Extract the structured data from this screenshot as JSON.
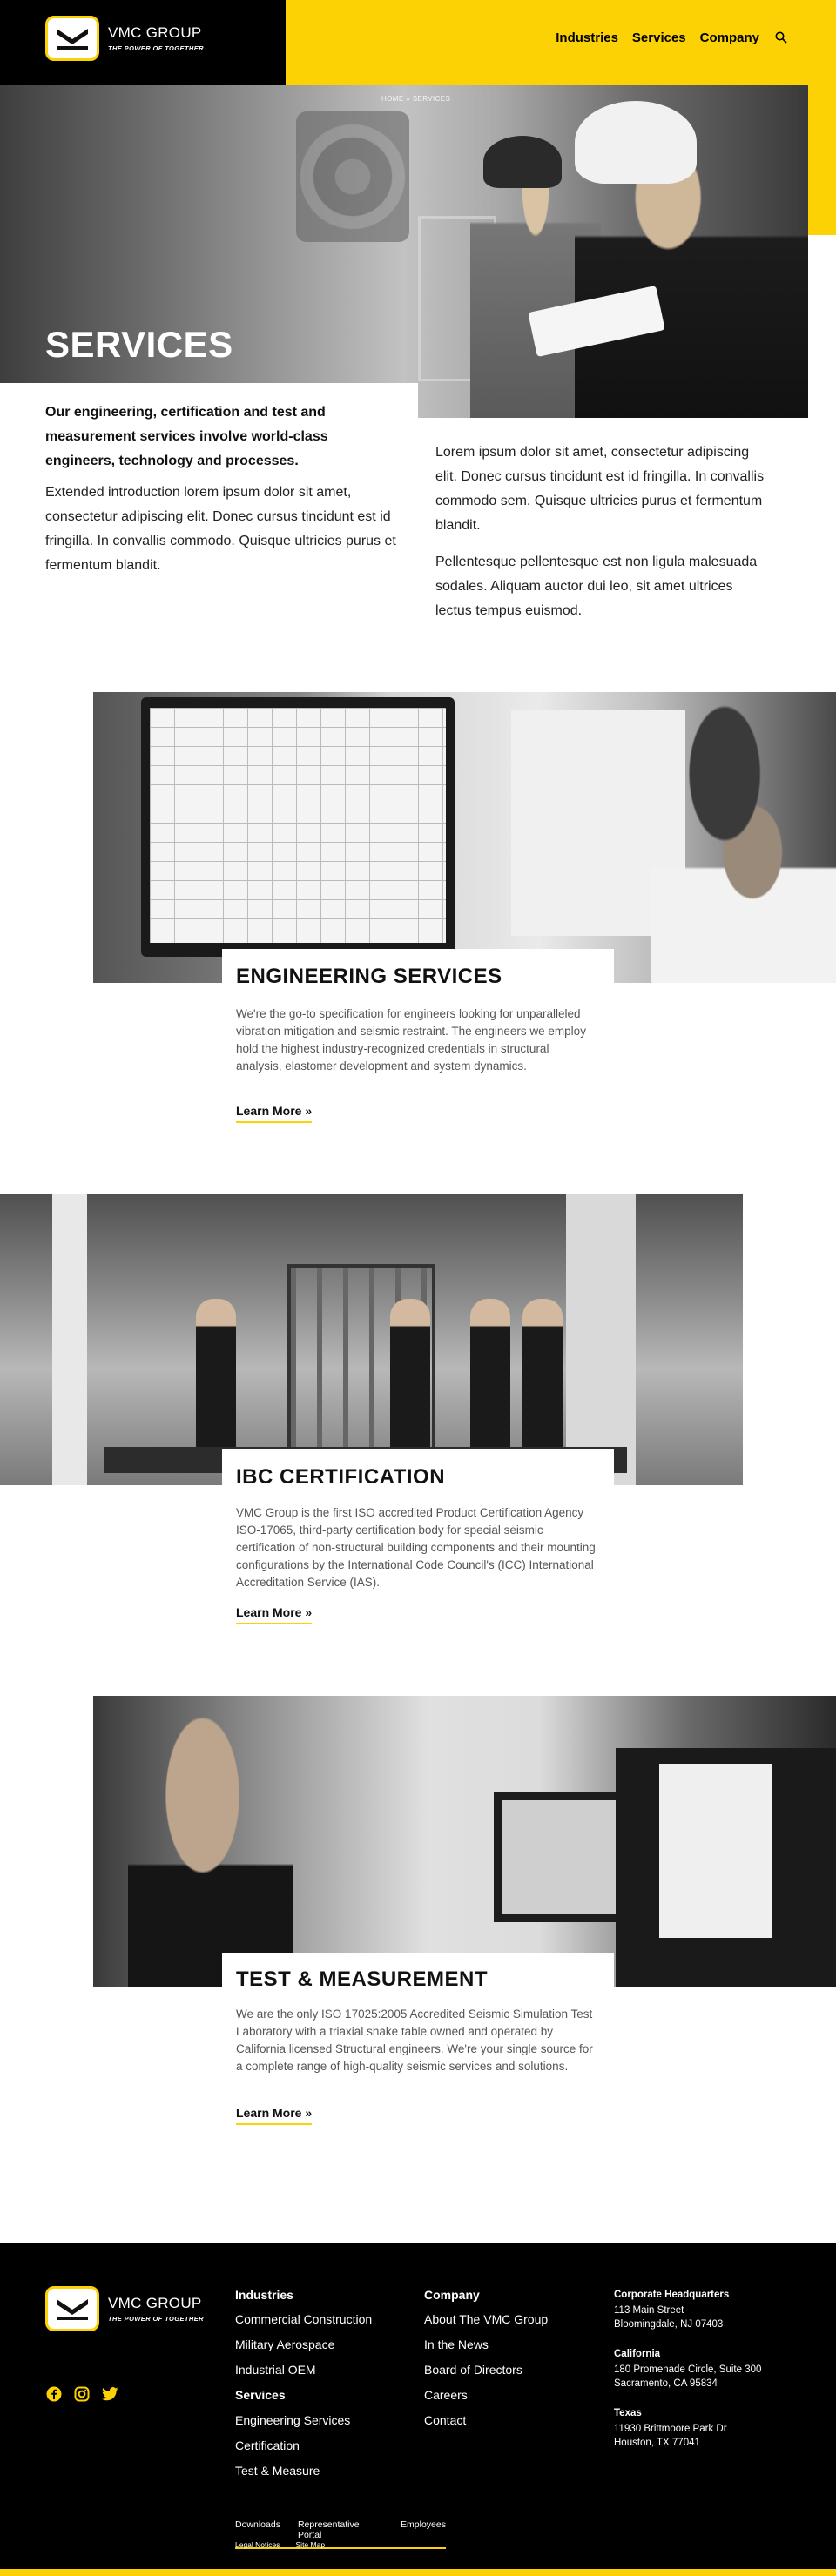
{
  "header": {
    "logo_name": "VMC GROUP",
    "logo_tagline": "THE POWER OF TOGETHER",
    "nav": [
      "Industries",
      "Services",
      "Company"
    ]
  },
  "hero": {
    "breadcrumb": [
      "HOME",
      "»",
      "SERVICES"
    ],
    "title": "SERVICES"
  },
  "intro": {
    "lead": "Our engineering, certification and test and measurement services involve world-class engineers, technology and processes.",
    "body": "Extended introduction lorem ipsum dolor sit amet, consectetur adipiscing elit. Donec cursus tincidunt est id fringilla. In convallis commodo. Quisque ultricies purus et fermentum blandit.",
    "right_p1": "Lorem ipsum dolor sit amet, consectetur adipiscing elit. Donec cursus tincidunt est id fringilla. In convallis commodo sem. Quisque ultricies purus et fermentum blandit.",
    "right_p2": "Pellentesque pellentesque est non ligula malesuada sodales. Aliquam auctor dui leo, sit amet ultrices lectus tempus euismod."
  },
  "services": [
    {
      "title": "ENGINEERING SERVICES",
      "description": "We're the go-to specification for engineers looking for unparalleled vibration mitigation and seismic restraint. The engineers we employ hold the highest industry-recognized credentials in structural analysis, elastomer development and system dynamics.",
      "link": "Learn More »"
    },
    {
      "title": "IBC CERTIFICATION",
      "description": "VMC Group is the first ISO accredited Product Certification Agency ISO-17065, third-party certification body for special seismic certification of non-structural building components and their mounting configurations by the International Code Council's (ICC) International Accreditation Service (IAS).",
      "link": "Learn More »"
    },
    {
      "title": "TEST & MEASUREMENT",
      "description": "We are the only ISO 17025:2005 Accredited Seismic Simulation Test Laboratory with a triaxial shake table owned and operated by California licensed Structural engineers. We're your single source for a complete range of high-quality seismic services and solutions.",
      "link": "Learn More »"
    }
  ],
  "footer": {
    "industries_head": "Industries",
    "industries": [
      "Commercial Construction",
      "Military Aerospace",
      "Industrial OEM"
    ],
    "services_head": "Services",
    "services": [
      "Engineering Services",
      "Certification",
      "Test & Measure"
    ],
    "company_head": "Company",
    "company": [
      "About The VMC Group",
      "In the News",
      "Board of Directors",
      "Careers",
      "Contact"
    ],
    "locations": [
      {
        "title": "Corporate Headquarters",
        "line1": "113 Main Street",
        "line2": "Bloomingdale, NJ 07403"
      },
      {
        "title": "California",
        "line1": "180 Promenade Circle, Suite 300",
        "line2": "Sacramento, CA 95834"
      },
      {
        "title": "Texas",
        "line1": "11930 Brittmoore Park Dr",
        "line2": "Houston, TX 77041"
      }
    ],
    "bottom_links": [
      "Downloads",
      "Representative Portal",
      "Employees"
    ],
    "legal_links": [
      "Legal Notices",
      "Site Map"
    ]
  },
  "colors": {
    "accent": "#fdd205",
    "dark": "#000000"
  }
}
